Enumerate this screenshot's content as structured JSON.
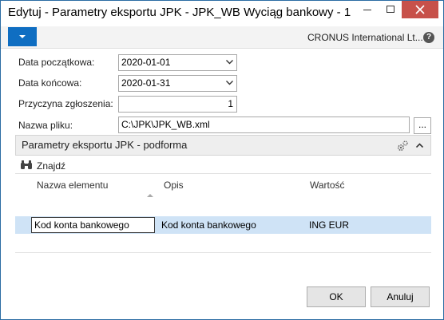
{
  "window": {
    "title": "Edytuj - Parametry eksportu JPK - JPK_WB Wyciąg bankowy - 1"
  },
  "ribbon": {
    "company": "CRONUS International Lt...",
    "help_label": "?"
  },
  "form": {
    "start_date_label": "Data początkowa:",
    "start_date_value": "2020-01-01",
    "end_date_label": "Data końcowa:",
    "end_date_value": "2020-01-31",
    "reason_label": "Przyczyna zgłoszenia:",
    "reason_value": "1",
    "file_label": "Nazwa pliku:",
    "file_value": "C:\\JPK\\JPK_WB.xml",
    "file_browse_label": "..."
  },
  "subform": {
    "title": "Parametry eksportu JPK - podforma",
    "find_label": "Znajdź",
    "columns": [
      "Nazwa elementu",
      "Opis",
      "Wartość"
    ],
    "rows": [
      {
        "name": "Kod konta bankowego",
        "description": "Kod konta bankowego",
        "value": "ING EUR"
      }
    ]
  },
  "footer": {
    "ok_label": "OK",
    "cancel_label": "Anuluj"
  },
  "colors": {
    "accent": "#0f6ec2",
    "selected_row": "#cfe3f6",
    "close_button": "#c7514a"
  }
}
